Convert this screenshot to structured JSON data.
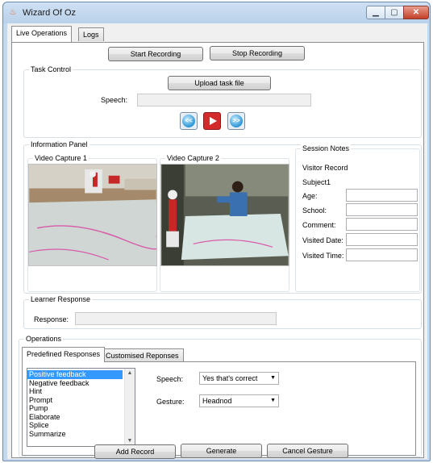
{
  "window": {
    "title": "Wizard Of Oz"
  },
  "main_tabs": [
    {
      "label": "Live Operations"
    },
    {
      "label": "Logs"
    }
  ],
  "recording": {
    "start_label": "Start Recording",
    "stop_label": "Stop Recording"
  },
  "task_control": {
    "label": "Task Control",
    "upload_label": "Upload task file",
    "speech_label": "Speech:",
    "speech_value": ""
  },
  "info_panel": {
    "label": "Information Panel",
    "video1_label": "Video Capture 1",
    "video2_label": "Video Capture 2"
  },
  "session_notes": {
    "label": "Session Notes",
    "visitor_record": "Visitor Record",
    "subject": "Subject1",
    "fields": [
      {
        "label": "Age:",
        "value": ""
      },
      {
        "label": "School:",
        "value": ""
      },
      {
        "label": "Comment:",
        "value": ""
      },
      {
        "label": "Visited Date:",
        "value": ""
      },
      {
        "label": "Visited Time:",
        "value": ""
      }
    ]
  },
  "learner_response": {
    "label": "Learner Response",
    "response_label": "Response:",
    "response_value": ""
  },
  "operations": {
    "label": "Operations",
    "tabs": [
      {
        "label": "Predefined Responses"
      },
      {
        "label": "Customised Reponses"
      }
    ],
    "responses": [
      {
        "label": "Positive feedback",
        "selected": true
      },
      {
        "label": "Negative feedback",
        "selected": false
      },
      {
        "label": "Hint",
        "selected": false
      },
      {
        "label": "Prompt",
        "selected": false
      },
      {
        "label": "Pump",
        "selected": false
      },
      {
        "label": "Elaborate",
        "selected": false
      },
      {
        "label": "Splice",
        "selected": false
      },
      {
        "label": "Summarize",
        "selected": false
      }
    ],
    "speech_label": "Speech:",
    "speech_value": "Yes that's correct",
    "gesture_label": "Gesture:",
    "gesture_value": "Headnod"
  },
  "bottom_buttons": {
    "add_record": "Add Record",
    "generate": "Generate",
    "cancel_gesture": "Cancel Gesture"
  },
  "icons": {
    "app": "app-icon",
    "rewind": "rewind-icon",
    "play": "play-icon",
    "forward": "fast-forward-icon"
  },
  "colors": {
    "selection": "#3399ff",
    "play_button": "#d22b2b",
    "window_frame": "#c4d9ee"
  }
}
